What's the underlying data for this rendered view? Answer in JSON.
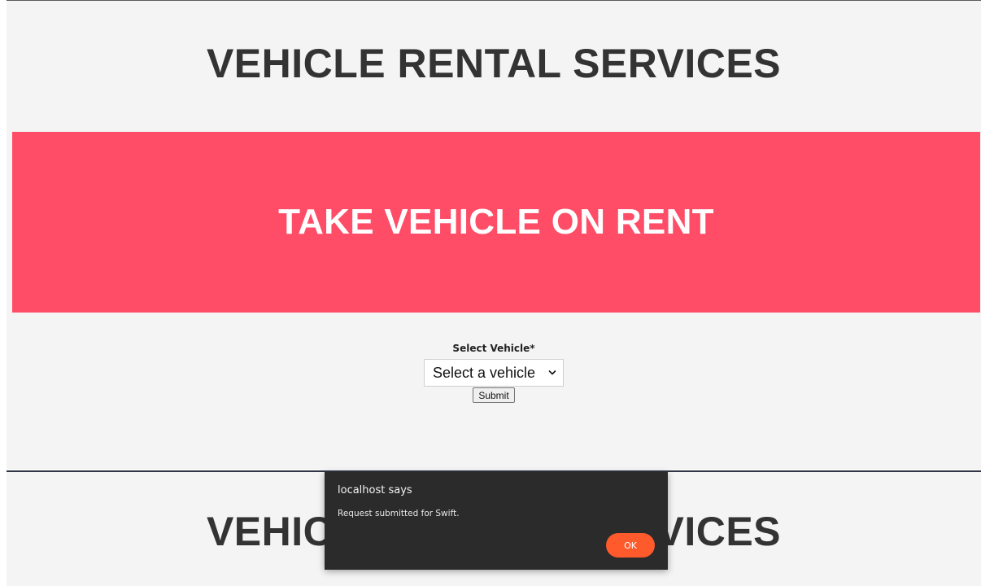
{
  "page": {
    "site_title": "VEHICLE RENTAL SERVICES",
    "banner_title": "TAKE VEHICLE ON RENT"
  },
  "form": {
    "vehicle_label": "Select Vehicle*",
    "vehicle_select": {
      "selected": "Select a vehicle",
      "options": [
        "Select a vehicle"
      ]
    },
    "submit_label": "Submit"
  },
  "dialog": {
    "title": "localhost says",
    "message": "Request submitted for Swift.",
    "ok_label": "OK"
  },
  "colors": {
    "banner": "#ff4d67",
    "panel_background": "#f4f4f4",
    "title_text": "#333333",
    "dialog_background": "#2b2b2b",
    "dialog_ok_button": "#ff5a2c"
  },
  "icons": {
    "select_arrow": "chevron-down-icon"
  }
}
